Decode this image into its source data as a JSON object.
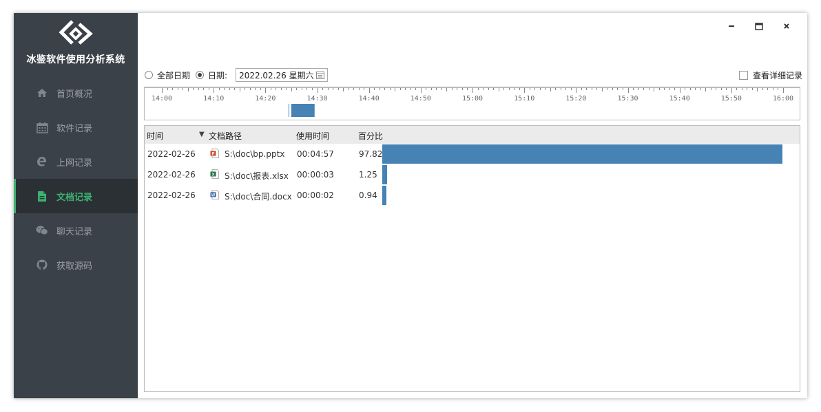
{
  "app": {
    "title": "冰鉴软件使用分析系统"
  },
  "sidebar": {
    "items": [
      {
        "label": "首页概况",
        "icon": "home-icon",
        "active": false
      },
      {
        "label": "软件记录",
        "icon": "calendar-icon",
        "active": false
      },
      {
        "label": "上网记录",
        "icon": "edge-icon",
        "active": false
      },
      {
        "label": "文档记录",
        "icon": "document-icon",
        "active": true
      },
      {
        "label": "聊天记录",
        "icon": "wechat-icon",
        "active": false
      },
      {
        "label": "获取源码",
        "icon": "github-icon",
        "active": false
      }
    ]
  },
  "window_controls": {
    "minimize": "−",
    "maximize": "□",
    "close": "×"
  },
  "filter": {
    "all_dates_label": "全部日期",
    "date_label": "日期:",
    "date_value": "2022.02.26 星期六",
    "selected": "date",
    "show_detail_label": "查看详细记录",
    "show_detail_checked": false
  },
  "timeline": {
    "ticks": [
      "14:00",
      "14:10",
      "14:20",
      "14:30",
      "14:40",
      "14:50",
      "15:00",
      "15:10",
      "15:20",
      "15:30",
      "15:40",
      "15:50",
      "16:00"
    ],
    "range_minutes": [
      0,
      120
    ],
    "marker_minute": 24.5,
    "usage_block_minutes": [
      25,
      29.5
    ]
  },
  "table": {
    "headers": {
      "time": "时间",
      "path": "文档路径",
      "duration": "使用时间",
      "percent": "百分比"
    },
    "sort_indicator": "▼",
    "rows": [
      {
        "date": "2022-02-26",
        "type": "pptx",
        "path": "S:\\doc\\bp.pptx",
        "duration": "00:04:57",
        "percent": "97.82",
        "percent_value": 97.82
      },
      {
        "date": "2022-02-26",
        "type": "xlsx",
        "path": "S:\\doc\\报表.xlsx",
        "duration": "00:00:03",
        "percent": "1.25",
        "percent_value": 1.25
      },
      {
        "date": "2022-02-26",
        "type": "docx",
        "path": "S:\\doc\\合同.docx",
        "duration": "00:00:02",
        "percent": "0.94",
        "percent_value": 0.94
      }
    ]
  },
  "colors": {
    "sidebar_bg": "#3b4148",
    "active_bg": "#2b3035",
    "active_accent": "#3cb371",
    "bar": "#4682b4"
  }
}
